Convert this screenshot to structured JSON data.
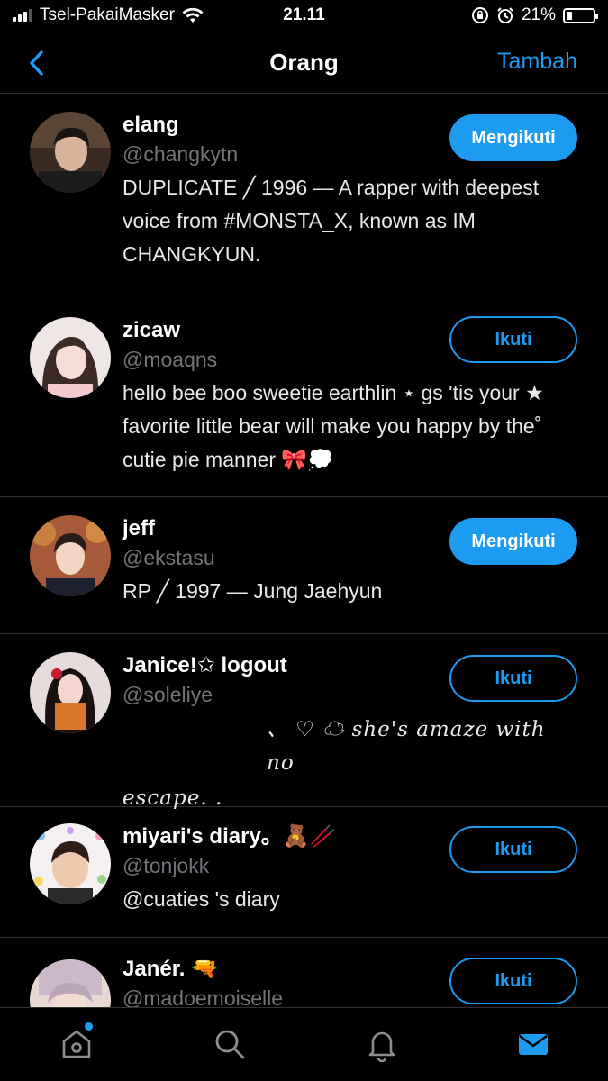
{
  "status_bar": {
    "carrier": "Tsel-PakaiMasker",
    "time": "21.11",
    "battery_percent": "21%",
    "battery_level": 0.21
  },
  "nav": {
    "title": "Orang",
    "action": "Tambah"
  },
  "people": [
    {
      "name": "elang",
      "handle": "@changkytn",
      "bio_1": "DUPLICATE ╱ 1996 — A rapper with deepest voice from #MONSTA_X, known as IM CHANGKYUN.",
      "button": "Mengikuti",
      "following": true
    },
    {
      "name": "zicaw",
      "handle": "@moaqns",
      "bio_1": "hello bee boo sweetie earthlin ⋆ gs 'tis your ★ favorite little bear will make you happy by the˚ cutie pie manner 🎀💭",
      "button": "Ikuti",
      "following": false
    },
    {
      "name": "jeff",
      "handle": "@ekstasu",
      "bio_1": "RP ╱ 1997 — Jung Jaehyun",
      "button": "Mengikuti",
      "following": true
    },
    {
      "name": "Janice!✩ logout",
      "handle": "@soleliye",
      "bio_1": "、 ♡ ☁ she's amaze with no",
      "bio_2": "escape. .",
      "button": "Ikuti",
      "following": false
    },
    {
      "name": "miyari's diary。🧸🥢",
      "handle": "@tonjokk",
      "bio_1": "@cuaties 's diary",
      "button": "Ikuti",
      "following": false
    },
    {
      "name": "Janér. 🔫",
      "handle": "@madoemoiselle",
      "button": "Ikuti",
      "following": false
    }
  ],
  "tabbar": {
    "icons": [
      "home-icon",
      "search-icon",
      "bell-icon",
      "mail-icon"
    ]
  },
  "colors": {
    "accent": "#1d9bf0",
    "background": "#000000",
    "secondary_text": "#71767b"
  }
}
